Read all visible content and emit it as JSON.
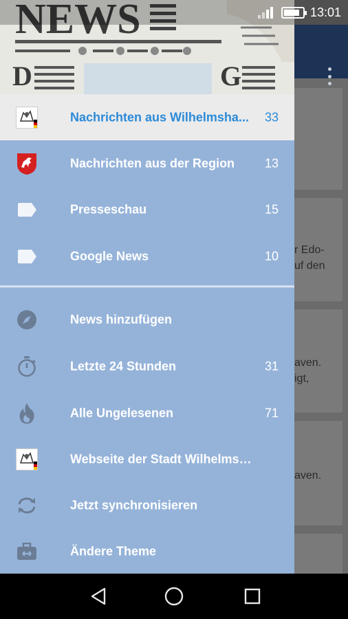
{
  "status_bar": {
    "time": "13:01"
  },
  "drawer": {
    "feeds": [
      {
        "label": "Nachrichten aus Wilhelmsha...",
        "count": "33",
        "icon": "wilhelmshaven-emblem-icon",
        "selected": true
      },
      {
        "label": "Nachrichten aus der Region",
        "count": "13",
        "icon": "lower-saxony-horse-icon"
      },
      {
        "label": "Presseschau",
        "count": "15",
        "icon": "tag-icon"
      },
      {
        "label": "Google News",
        "count": "10",
        "icon": "tag-icon"
      }
    ],
    "actions": [
      {
        "label": "News hinzufügen",
        "count": "",
        "icon": "compass-icon"
      },
      {
        "label": "Letzte 24 Stunden",
        "count": "31",
        "icon": "stopwatch-icon"
      },
      {
        "label": "Alle Ungelesenen",
        "count": "71",
        "icon": "flame-icon"
      },
      {
        "label": "Webseite der Stadt Wilhelmsha...",
        "count": "",
        "icon": "wilhelmshaven-emblem-icon"
      },
      {
        "label": "Jetzt synchronisieren",
        "count": "",
        "icon": "sync-icon"
      },
      {
        "label": "Ändere Theme",
        "count": "",
        "icon": "theme-briefcase-icon"
      }
    ]
  },
  "background": {
    "card_fragments": [
      [
        "r Edo-",
        "uf den"
      ],
      [
        "aven.",
        "igt,"
      ],
      [
        "aven."
      ]
    ]
  },
  "colors": {
    "drawer": "#95b3d9",
    "selected": "#ebebeb",
    "accent": "#2a8ad8",
    "toolbar": "#1d3355"
  }
}
